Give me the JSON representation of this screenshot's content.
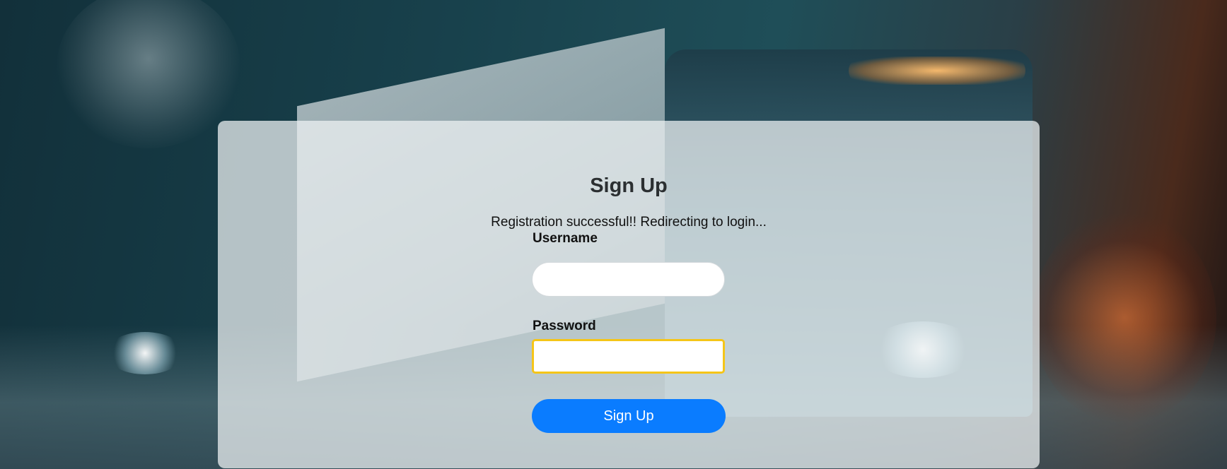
{
  "signup_form": {
    "title": "Sign Up",
    "status_message": "Registration successful!! Redirecting to login...",
    "username_label": "Username",
    "username_value": "",
    "password_label": "Password",
    "password_value": "",
    "submit_label": "Sign Up"
  },
  "colors": {
    "primary_button": "#0a7cff",
    "focus_border": "#f5c518",
    "card_background": "rgba(238,242,243,0.74)"
  }
}
